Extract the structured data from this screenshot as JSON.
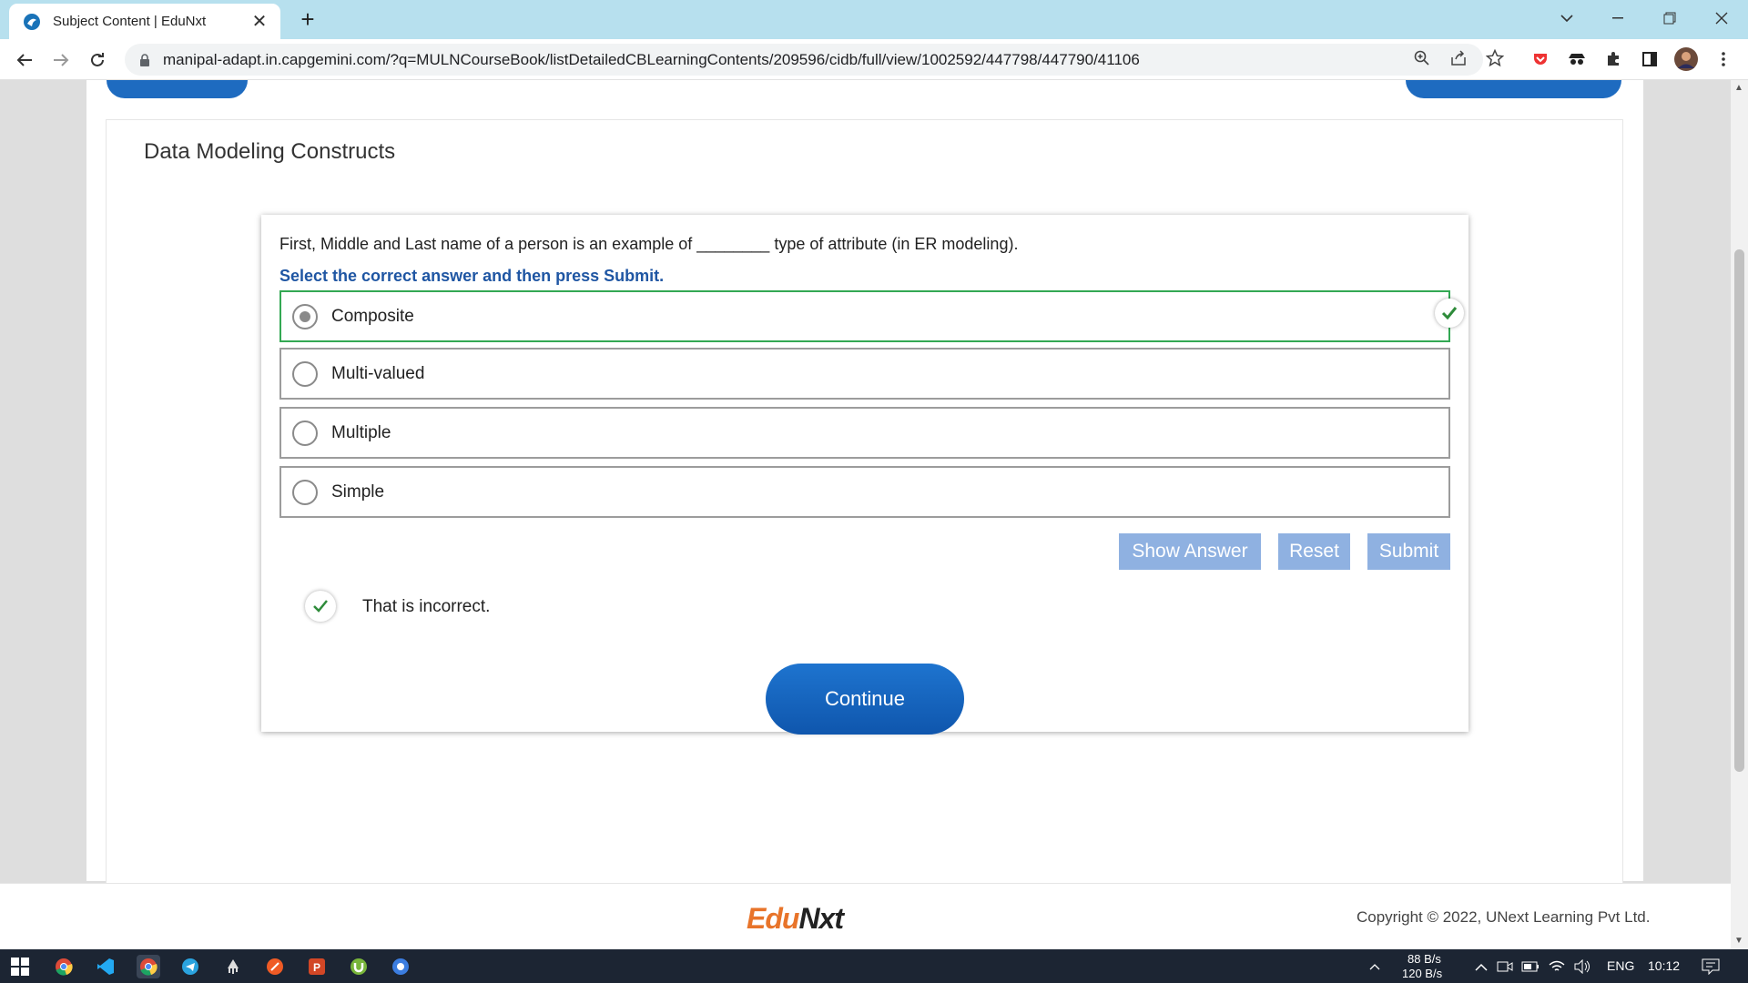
{
  "browser": {
    "tab_title": "Subject Content | EduNxt",
    "url": "manipal-adapt.in.capgemini.com/?q=MULNCourseBook/listDetailedCBLearningContents/209596/cidb/full/view/1002592/447798/447790/41106"
  },
  "content": {
    "section_title": "Data Modeling Constructs",
    "question": "First, Middle and Last name of a person is an example of ________ type of attribute (in ER modeling).",
    "instruction": "Select the correct answer and then press Submit.",
    "options": [
      {
        "label": "Composite",
        "selected": true,
        "correct": true
      },
      {
        "label": "Multi-valued",
        "selected": false,
        "correct": false
      },
      {
        "label": "Multiple",
        "selected": false,
        "correct": false
      },
      {
        "label": "Simple",
        "selected": false,
        "correct": false
      }
    ],
    "buttons": {
      "show_answer": "Show Answer",
      "reset": "Reset",
      "submit": "Submit"
    },
    "feedback": "That is incorrect.",
    "continue_label": "Continue"
  },
  "footer": {
    "logo_edu": "Edu",
    "logo_nxt": "Nxt",
    "copyright": "Copyright © 2022, UNext Learning Pvt Ltd."
  },
  "taskbar": {
    "net_up": "88 B/s",
    "net_down": "120 B/s",
    "language": "ENG",
    "time": "10:12"
  },
  "colors": {
    "accent_blue": "#1e6bc0",
    "instruction_blue": "#1f56a3",
    "correct_green": "#33a853",
    "button_disabled": "#8fb1e1",
    "brand_orange": "#e8742a"
  }
}
